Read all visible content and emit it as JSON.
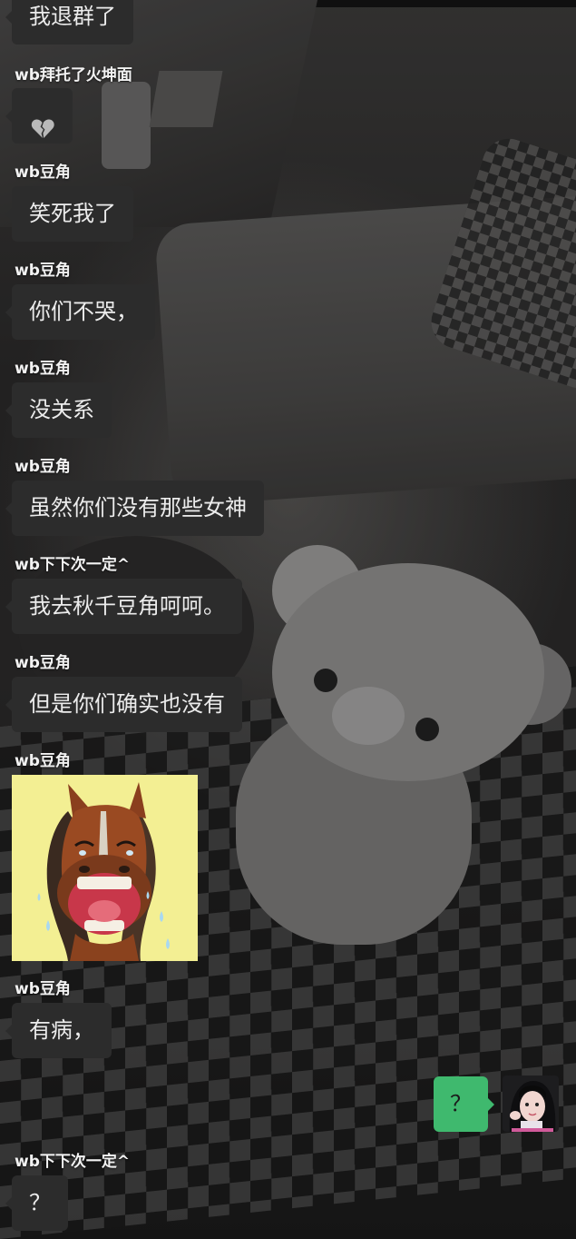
{
  "messages": [
    {
      "text": "我退群了"
    },
    {
      "sender": "wb拜托了火坤面",
      "icon": "broken-heart-icon"
    },
    {
      "sender": "wb豆角",
      "text": "笑死我了"
    },
    {
      "sender": "wb豆角",
      "text": "你们不哭，"
    },
    {
      "sender": "wb豆角",
      "text": "没关系"
    },
    {
      "sender": "wb豆角",
      "text": "虽然你们没有那些女神"
    },
    {
      "sender": "wb下下次一定^",
      "text": "我去秋千豆角呵呵。"
    },
    {
      "sender": "wb豆角",
      "text": "但是你们确实也没有"
    },
    {
      "sender": "wb豆角",
      "sticker": "crying-laughing-horse"
    },
    {
      "sender": "wb豆角",
      "text": "有病，"
    },
    {
      "text": "？",
      "mine": true
    },
    {
      "sender": "wb下下次一定^",
      "text": "？"
    }
  ],
  "colors": {
    "incoming_bubble": "#2c2c2c",
    "outgoing_bubble": "#3fb96e",
    "sender_name": "#f2f2f2"
  }
}
